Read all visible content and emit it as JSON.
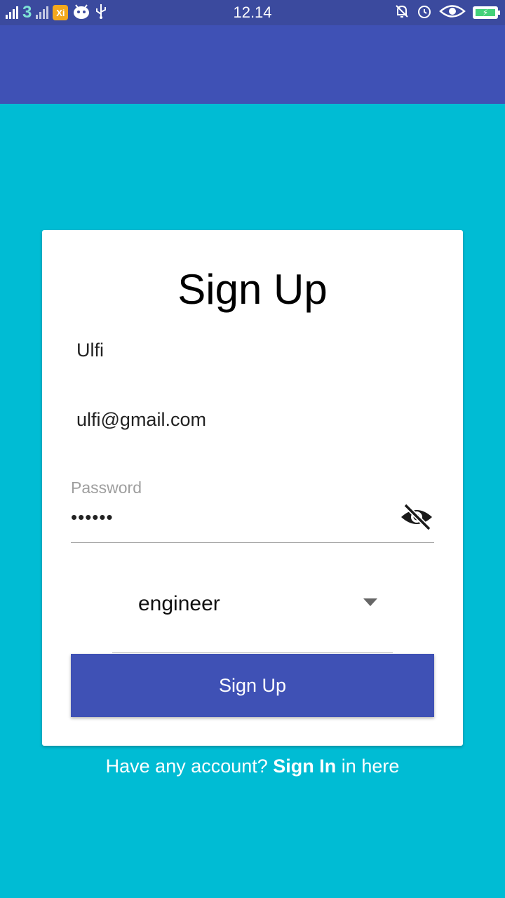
{
  "status_bar": {
    "time": "12.14",
    "carrier_glyph": "3",
    "app_badge": "Xi",
    "icons_left": [
      "signal-icon",
      "carrier-3-icon",
      "signal-icon",
      "app-notification-icon",
      "android-icon",
      "usb-icon"
    ],
    "icons_right": [
      "bell-off-icon",
      "alarm-icon",
      "eye-icon",
      "battery-charging-icon"
    ]
  },
  "colors": {
    "status_bar": "#3B4A9E",
    "app_bar": "#3F51B5",
    "background": "#00BCD4",
    "card": "#FFFFFF",
    "button": "#3F51B5"
  },
  "form": {
    "title": "Sign Up",
    "name_value": "Ulfi",
    "email_value": "ulfi@gmail.com",
    "password_label": "Password",
    "password_value": "••••••",
    "role_selected": "engineer",
    "submit_label": "Sign Up"
  },
  "footer": {
    "prefix": "Have any account? ",
    "link": "Sign In",
    "suffix": " in here"
  }
}
